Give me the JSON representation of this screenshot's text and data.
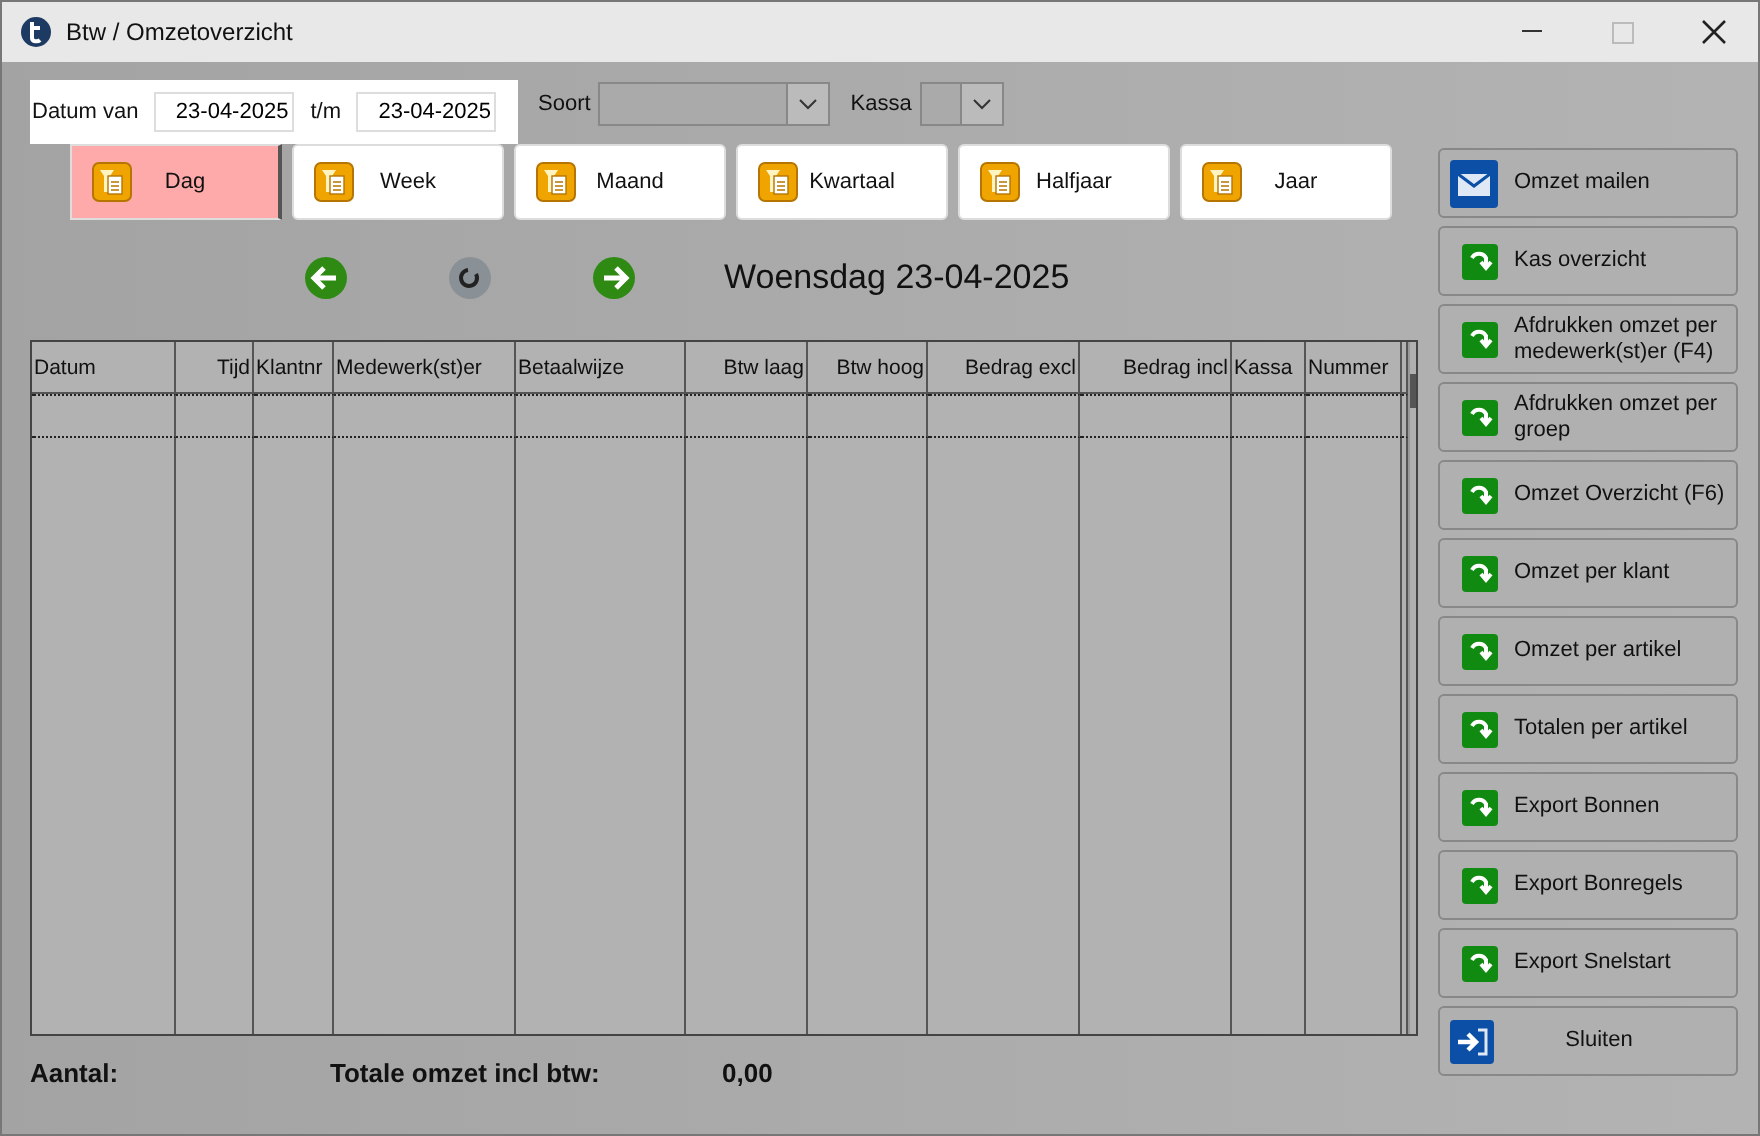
{
  "window": {
    "title": "Btw / Omzetoverzicht"
  },
  "filters": {
    "from_label": "Datum van",
    "from_value": "23-04-2025",
    "to_label": "t/m",
    "to_value": "23-04-2025",
    "type_label": "Soort",
    "register_label": "Kassa"
  },
  "tabs": [
    {
      "label": "Dag",
      "selected": true
    },
    {
      "label": "Week",
      "selected": false
    },
    {
      "label": "Maand",
      "selected": false
    },
    {
      "label": "Kwartaal",
      "selected": false
    },
    {
      "label": "Halfjaar",
      "selected": false
    },
    {
      "label": "Jaar",
      "selected": false
    }
  ],
  "date_heading": "Woensdag 23-04-2025",
  "table": {
    "columns": [
      {
        "label": "Datum",
        "kind": "text"
      },
      {
        "label": "Tijd",
        "kind": "number"
      },
      {
        "label": "Klantnr",
        "kind": "text"
      },
      {
        "label": "Medewerk(st)er",
        "kind": "text"
      },
      {
        "label": "Betaalwijze",
        "kind": "text"
      },
      {
        "label": "Btw laag",
        "kind": "number"
      },
      {
        "label": "Btw hoog",
        "kind": "number"
      },
      {
        "label": "Bedrag excl",
        "kind": "number"
      },
      {
        "label": "Bedrag incl",
        "kind": "number"
      },
      {
        "label": "Kassa",
        "kind": "text"
      },
      {
        "label": "Nummer",
        "kind": "text"
      }
    ]
  },
  "footer": {
    "count_label": "Aantal:",
    "total_label": "Totale omzet incl btw:",
    "total_value": "0,00"
  },
  "actions": [
    {
      "label": "Omzet mailen",
      "kind": "mail"
    },
    {
      "label": "Kas overzicht",
      "kind": "report"
    },
    {
      "label": "Afdrukken omzet per medewerk(st)er (F4)",
      "kind": "report"
    },
    {
      "label": "Afdrukken omzet per groep",
      "kind": "report"
    },
    {
      "label": "Omzet Overzicht (F6)",
      "kind": "report"
    },
    {
      "label": "Omzet per klant",
      "kind": "report"
    },
    {
      "label": "Omzet per artikel",
      "kind": "report"
    },
    {
      "label": "Totalen per artikel",
      "kind": "report"
    },
    {
      "label": "Export Bonnen",
      "kind": "report"
    },
    {
      "label": "Export Bonregels",
      "kind": "report"
    },
    {
      "label": "Export Snelstart",
      "kind": "report"
    },
    {
      "label": "Sluiten",
      "kind": "exit"
    }
  ]
}
